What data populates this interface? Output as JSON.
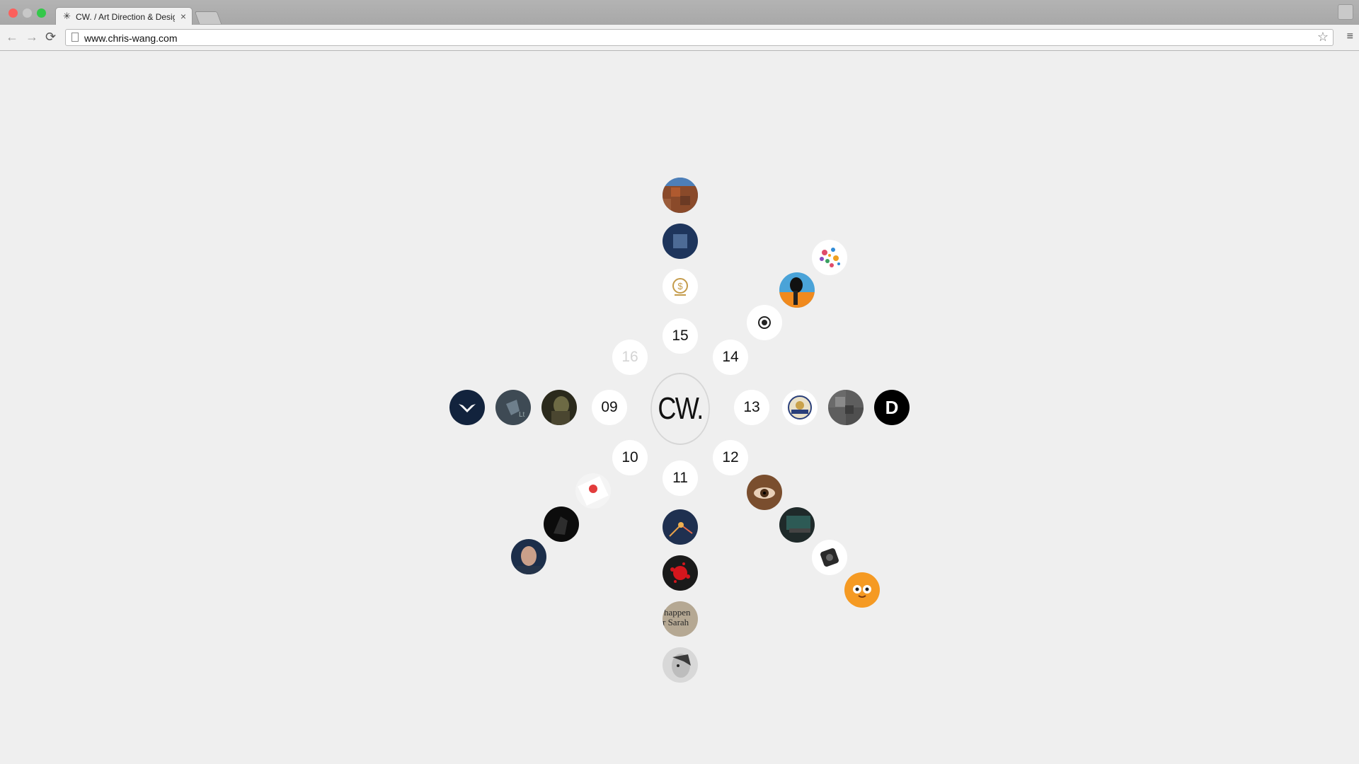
{
  "browser": {
    "tab_title": "CW. / Art Direction & Design",
    "tab_close": "×",
    "tab_favicon": "sparkle-icon",
    "url": "www.chris-wang.com",
    "nav": {
      "back": "←",
      "forward": "→",
      "reload": "⟳"
    },
    "star": "☆",
    "menu": "≡"
  },
  "page": {
    "logo": "CW.",
    "numbers": {
      "n09": "09",
      "n10": "10",
      "n11": "11",
      "n12": "12",
      "n13": "13",
      "n14": "14",
      "n15": "15",
      "n16": "16"
    },
    "thumbs": {
      "left_d": "D"
    }
  }
}
